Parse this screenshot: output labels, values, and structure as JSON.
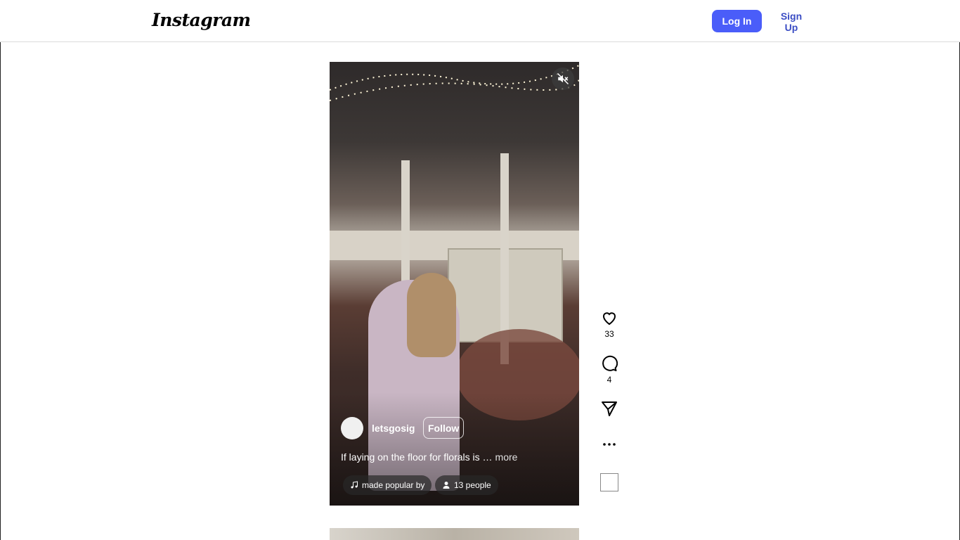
{
  "header": {
    "logo_text": "Instagram",
    "login_label": "Log In",
    "signup_label": "Sign Up"
  },
  "reel": {
    "username": "letsgosig",
    "follow_label": "Follow",
    "caption": "If laying on the floor for florals is …",
    "caption_more": "more",
    "audio_label": "made popular by",
    "people_label": "13 people",
    "likes_count": "33",
    "comments_count": "4"
  },
  "icons": {
    "mute": "volume-muted-icon",
    "like": "heart-icon",
    "comment": "comment-icon",
    "share": "paper-plane-icon",
    "more": "more-dots-icon",
    "audio": "music-note-icon",
    "people": "person-icon"
  },
  "colors": {
    "primary_button": "#4a5df9",
    "link": "#3b4dc4",
    "border": "#dbdbdb"
  }
}
